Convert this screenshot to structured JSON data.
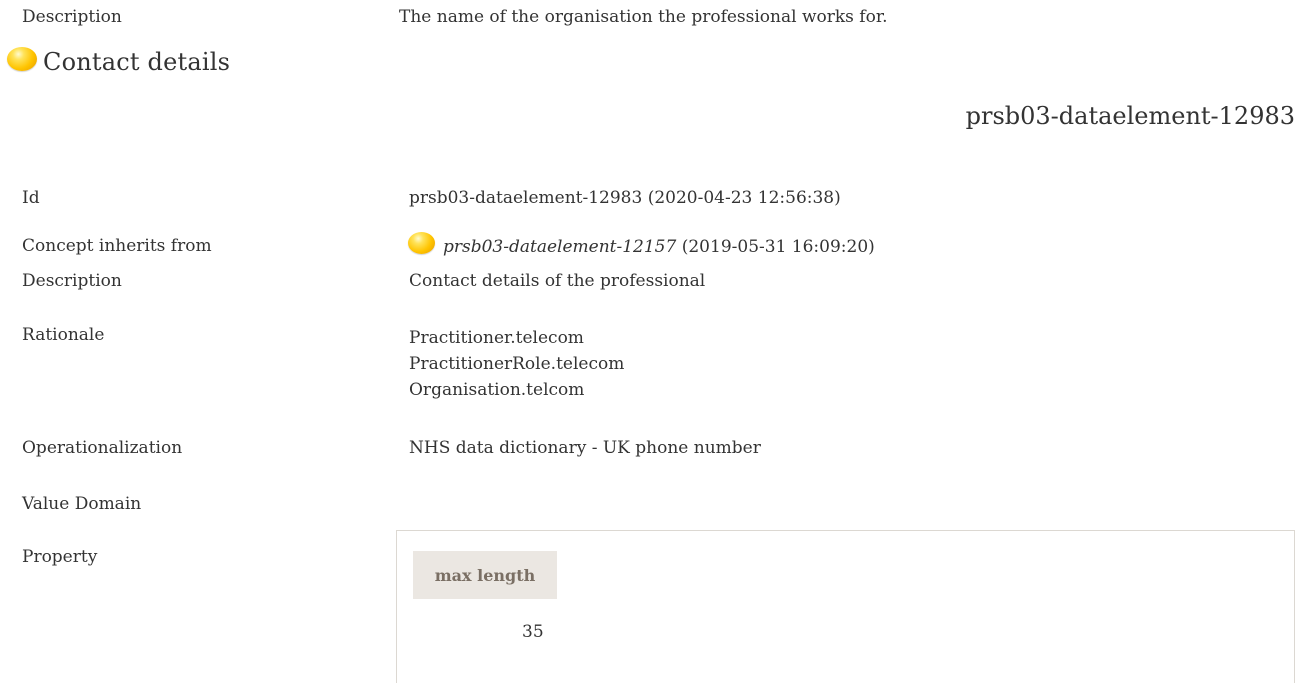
{
  "previous": {
    "description_label": "Description",
    "description_value": "The name of the organisation the professional works for."
  },
  "section": {
    "title": "Contact details",
    "element_id": "prsb03-dataelement-12983",
    "icon": "yellow-ball-icon",
    "icon_color": "#ffc400"
  },
  "fields": {
    "id": {
      "label": "Id",
      "value": "prsb03-dataelement-12983 (2020-04-23 12:56:38)"
    },
    "inherits": {
      "label": "Concept inherits from",
      "link": "prsb03-dataelement-12157",
      "date": "(2019-05-31 16:09:20)"
    },
    "description": {
      "label": "Description",
      "value": "Contact details of the professional"
    },
    "rationale": {
      "label": "Rationale",
      "lines": [
        "Practitioner.telecom",
        "PractitionerRole.telecom",
        "Organisation.telcom"
      ]
    },
    "operationalization": {
      "label": "Operationalization",
      "value": "NHS data dictionary - UK phone number"
    },
    "value_domain": {
      "label": "Value Domain"
    },
    "property": {
      "label": "Property",
      "header": "max length",
      "value": "35"
    }
  }
}
